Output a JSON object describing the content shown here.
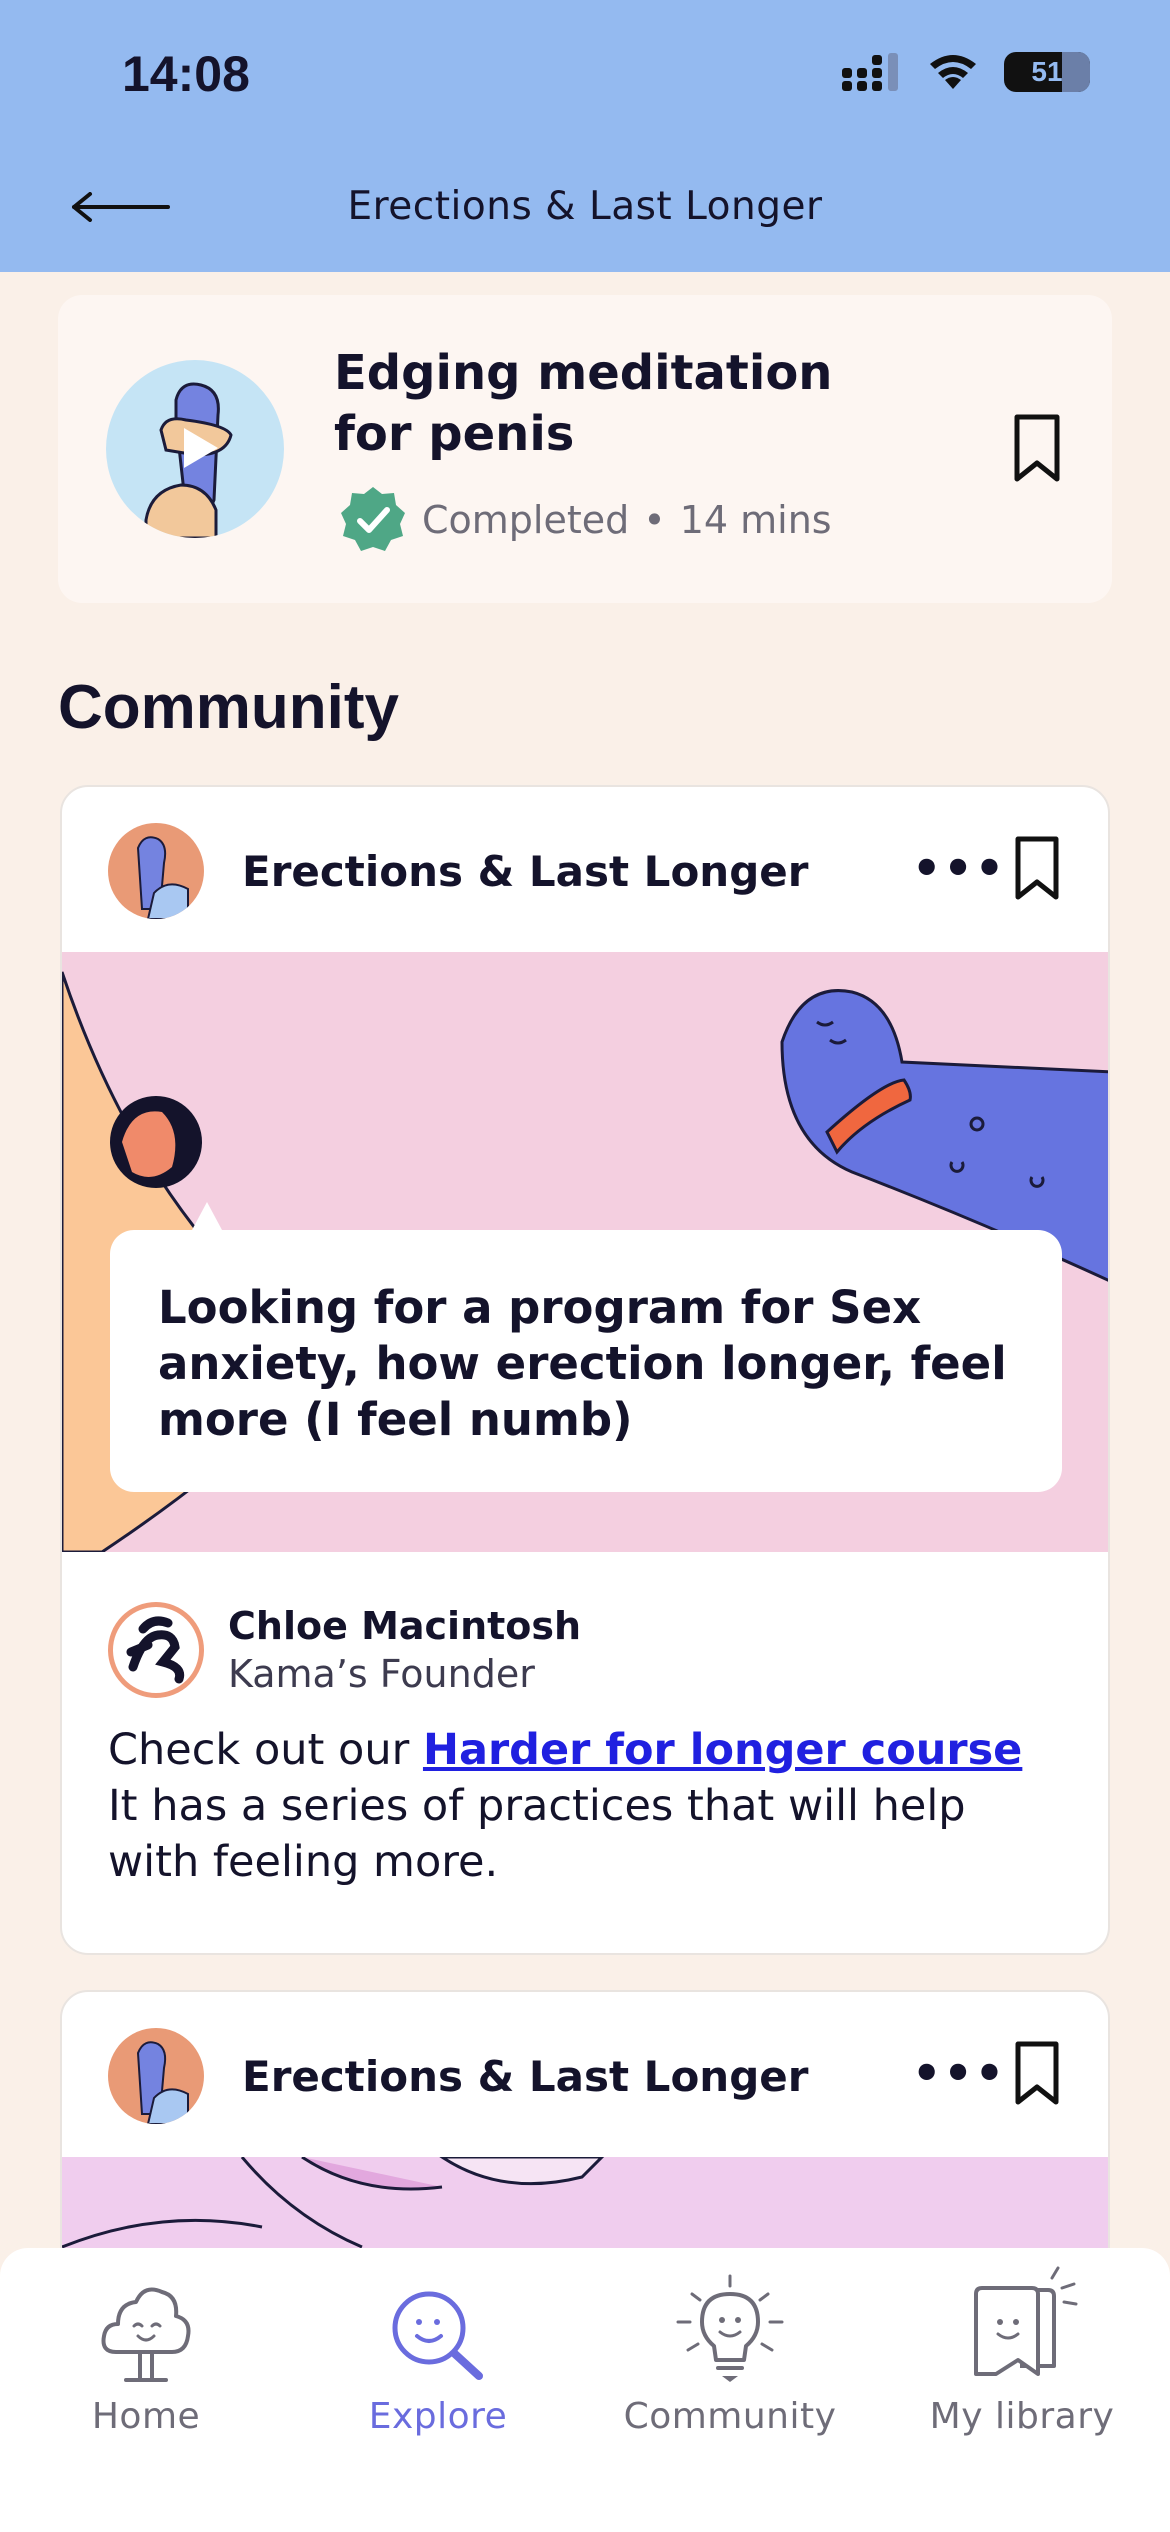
{
  "status_bar": {
    "time": "14:08",
    "battery": "51"
  },
  "header": {
    "title": "Erections & Last Longer"
  },
  "lesson": {
    "title_line1": "Edging meditation",
    "title_line2": "for penis",
    "status": "Completed",
    "separator": "•",
    "duration": "14 mins"
  },
  "community": {
    "section_title": "Community",
    "posts": [
      {
        "category": "Erections & Last Longer",
        "more": "•••",
        "question": "Looking for a program for Sex anxiety, how erection longer, feel more (I feel numb)",
        "reply": {
          "author": "Chloe Macintosh",
          "role": "Kama’s Founder",
          "text_prefix": "Check out our ",
          "link": "Harder for longer course",
          "text_suffix": "It has a series of practices that will help with feeling more."
        }
      },
      {
        "category": "Erections & Last Longer",
        "more": "•••"
      }
    ]
  },
  "tabbar": {
    "tabs": [
      {
        "label": "Home",
        "icon": "home-cloud-tree-icon",
        "active": false
      },
      {
        "label": "Explore",
        "icon": "explore-magnifier-icon",
        "active": true
      },
      {
        "label": "Community",
        "icon": "community-lightbulb-icon",
        "active": false
      },
      {
        "label": "My library",
        "icon": "library-books-icon",
        "active": false
      }
    ]
  },
  "colors": {
    "header_bg": "#94BAF0",
    "page_bg": "#FAF0E8",
    "active_tab": "#6A6CDE",
    "link": "#2020E0",
    "completed_badge": "#4FA786"
  }
}
